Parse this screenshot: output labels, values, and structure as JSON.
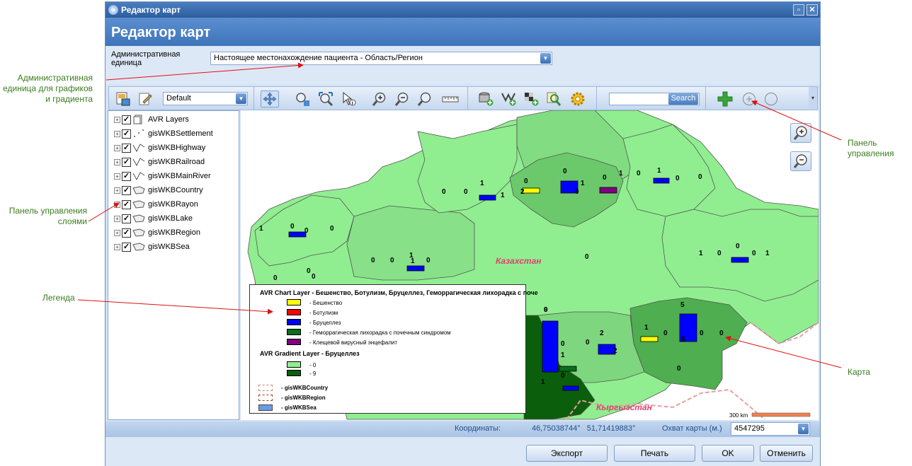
{
  "annotations": {
    "admin_unit": "Административная\nединица для графиков\nи градиента",
    "layers_panel": "Панель управления\nслоями",
    "legend": "Легенда",
    "control_panel": "Панель\nуправления",
    "map": "Карта"
  },
  "window": {
    "title": "Редактор карт",
    "header": "Редактор карт"
  },
  "admin": {
    "label": "Административная\nединица",
    "value": "Настоящее местонахождение пациента - Область/Регион"
  },
  "toolbar": {
    "style_value": "Default",
    "search_button": "Search",
    "search_placeholder": "",
    "tools": [
      "pan-icon",
      "zoom-extent-icon",
      "zoom-full-icon",
      "info-icon",
      "zoom-in-icon",
      "zoom-out-icon",
      "zoom-box-icon",
      "ruler-icon",
      "add-layer-icon",
      "add-chart-icon",
      "add-gradient-icon",
      "search-layer-icon",
      "settings-icon",
      "add-icon",
      "add-point-icon",
      "circle-icon"
    ]
  },
  "layers": [
    {
      "name": "AVR Layers",
      "icon": "avr-layers-icon"
    },
    {
      "name": "gisWKBSettlement",
      "icon": "point-layer-icon"
    },
    {
      "name": "gisWKBHighway",
      "icon": "line-layer-icon"
    },
    {
      "name": "gisWKBRailroad",
      "icon": "line-layer-icon"
    },
    {
      "name": "gisWKBMainRiver",
      "icon": "line-layer-icon"
    },
    {
      "name": "gisWKBCountry",
      "icon": "polygon-layer-icon"
    },
    {
      "name": "gisWKBRayon",
      "icon": "polygon-layer-icon"
    },
    {
      "name": "gisWKBLake",
      "icon": "polygon-layer-icon"
    },
    {
      "name": "gisWKBRegion",
      "icon": "polygon-layer-icon"
    },
    {
      "name": "gisWKBSea",
      "icon": "polygon-layer-icon"
    }
  ],
  "map": {
    "country_label": "Казахстан",
    "neighbor_label": "Кыргызстан",
    "scale_label": "300 km",
    "counts": [
      "1",
      "0",
      "0",
      "1",
      "0",
      "2",
      "0",
      "1",
      "0",
      "0",
      "1",
      "0",
      "1",
      "0",
      "0",
      "0",
      "1",
      "0",
      "0",
      "0",
      "1",
      "0",
      "1",
      "0",
      "0",
      "1",
      "0",
      "0",
      "1",
      "0",
      "0",
      "0",
      "0",
      "1",
      "0",
      "9",
      "0",
      "1",
      "2",
      "0",
      "1",
      "0",
      "5",
      "0",
      "0",
      "0",
      "0",
      "1",
      "0",
      "5",
      "2"
    ]
  },
  "legend": {
    "chart_title": "AVR Chart Layer - Бешенство, Ботулизм, Бруцеллез, Геморрагическая лихорадка с поче",
    "chart_items": [
      {
        "label": "- Бешенство",
        "color": "#ffff00"
      },
      {
        "label": "- Ботулизм",
        "color": "#ff0000"
      },
      {
        "label": "- Бруцеллез",
        "color": "#0000ff"
      },
      {
        "label": "- Геморрагическая лихорадка с почечным синдромом",
        "color": "#0a6e1a"
      },
      {
        "label": "- Клещевой вирусный энцефалит",
        "color": "#800080"
      }
    ],
    "gradient_title": "AVR Gradient Layer - Бруцеллез",
    "gradient_items": [
      {
        "label": "- 0",
        "color": "#90ee90"
      },
      {
        "label": "- 9",
        "color": "#0b5e0b"
      }
    ],
    "layer_items": [
      {
        "label": "- gisWKBCountry"
      },
      {
        "label": "- gisWKBRegion"
      },
      {
        "label": "- gisWKBSea"
      }
    ]
  },
  "status": {
    "coords_label": "Координаты:",
    "coords_value": "46,75038744°   51,71419883°",
    "coverage_label": "Охват карты (м.)",
    "coverage_value": "4547295"
  },
  "buttons": {
    "export": "Экспорт",
    "print": "Печать",
    "ok": "OK",
    "cancel": "Отменить"
  }
}
